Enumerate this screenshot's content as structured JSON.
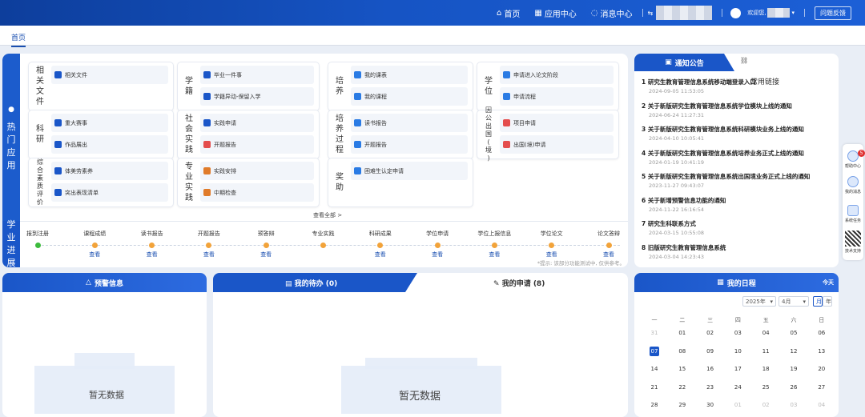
{
  "header": {
    "nav": [
      "首页",
      "应用中心",
      "消息中心"
    ],
    "welcome": "欢迎您,",
    "feedback": "问题反馈"
  },
  "tabs": [
    "首页"
  ],
  "hot_apps": {
    "label": "热门应用",
    "cards": [
      {
        "cat": "相关文件",
        "items": [
          "相关文件"
        ]
      },
      {
        "cat": "学籍",
        "items": [
          "毕业一件事",
          "学籍异动-保留入学"
        ]
      },
      {
        "cat": "培养",
        "items": [
          "我的课表",
          "我的课程"
        ]
      },
      {
        "cat": "学位",
        "items": [
          "申请进入论文阶段",
          "申请流程"
        ]
      },
      {
        "cat": "科研",
        "items": [
          "重大赛事",
          "作品展出"
        ]
      },
      {
        "cat": "社会实践",
        "items": [
          "实践申请",
          "开题报告"
        ]
      },
      {
        "cat": "培养过程",
        "items": [
          "读书报告",
          "开题报告"
        ]
      },
      {
        "cat": "因公出国(境)",
        "items": [
          "项目申请",
          "出国(境)申请"
        ]
      },
      {
        "cat": "综合素质评价",
        "items": [
          "体美劳素养",
          "突出表现清单"
        ]
      },
      {
        "cat": "专业实践",
        "items": [
          "实践安排",
          "中期检查"
        ]
      },
      {
        "cat": "奖助",
        "items": [
          "困难生认定申请"
        ]
      }
    ],
    "see_all": "查看全部 >"
  },
  "progress": {
    "label": "学业进展",
    "steps": [
      {
        "name": "报到注册",
        "status": "done",
        "link": ""
      },
      {
        "name": "课程成绩",
        "status": "pending",
        "link": "查看"
      },
      {
        "name": "读书报告",
        "status": "pending",
        "link": "查看"
      },
      {
        "name": "开题报告",
        "status": "pending",
        "link": "查看"
      },
      {
        "name": "预答辩",
        "status": "pending",
        "link": "查看"
      },
      {
        "name": "专业实践",
        "status": "pending",
        "link": ""
      },
      {
        "name": "科研成果",
        "status": "pending",
        "link": "查看"
      },
      {
        "name": "学位申请",
        "status": "pending",
        "link": "查看"
      },
      {
        "name": "学位上报信息",
        "status": "pending",
        "link": "查看"
      },
      {
        "name": "学位论文",
        "status": "pending",
        "link": "查看"
      },
      {
        "name": "论文答辩",
        "status": "pending",
        "link": "查看"
      }
    ],
    "hint": "*提示: 该部分功能测试中, 仅供参考。",
    "colors": {
      "done": "#3dbb3d",
      "pending": "#f2a33a"
    }
  },
  "notice": {
    "tab": "通知公告",
    "link_tab": "常用链接",
    "items": [
      {
        "n": "1",
        "title": "研究生教育管理信息系统移动端登录入口",
        "date": "2024-09-05 11:53:05"
      },
      {
        "n": "2",
        "title": "关于新版研究生教育管理信息系统学位模块上线的通知",
        "date": "2024-06-24 11:27:31"
      },
      {
        "n": "3",
        "title": "关于新版研究生教育管理信息系统科研模块业务上线的通知",
        "date": "2024-04-10 10:05:41"
      },
      {
        "n": "4",
        "title": "关于新版研究生教育管理信息系统培养业务正式上线的通知",
        "date": "2024-01-19 10:41:19"
      },
      {
        "n": "5",
        "title": "关于新版研究生教育管理信息系统出国境业务正式上线的通知",
        "date": "2023-11-27 09:43:07"
      },
      {
        "n": "6",
        "title": "关于新增预警信息功能的通知",
        "date": "2024-11-22 16:16:54"
      },
      {
        "n": "7",
        "title": "研究生科联系方式",
        "date": "2024-03-15 10:55:08"
      },
      {
        "n": "8",
        "title": "旧版研究生教育管理信息系统",
        "date": "2024-03-04 14:23:43"
      }
    ]
  },
  "warning": {
    "title": "预警信息",
    "empty": "暂无数据"
  },
  "todo": {
    "tab_todo": "我的待办 (0)",
    "tab_apply": "我的申请 (8)",
    "empty": "暂无数据"
  },
  "calendar": {
    "title": "我的日程",
    "today": "今天",
    "year": "2025年",
    "month": "4月",
    "mode_month": "月",
    "mode_year": "年",
    "weekdays": [
      "一",
      "二",
      "三",
      "四",
      "五",
      "六",
      "日"
    ],
    "rows": [
      [
        "31",
        "01",
        "02",
        "03",
        "04",
        "05",
        "06"
      ],
      [
        "07",
        "08",
        "09",
        "10",
        "11",
        "12",
        "13"
      ],
      [
        "14",
        "15",
        "16",
        "17",
        "18",
        "19",
        "20"
      ],
      [
        "21",
        "22",
        "23",
        "24",
        "25",
        "26",
        "27"
      ],
      [
        "28",
        "29",
        "30",
        "01",
        "02",
        "03",
        "04"
      ]
    ]
  },
  "sidebar": {
    "items": [
      "帮助中心",
      "我的消息",
      "系统任务",
      "技术支持"
    ],
    "badge": "5"
  }
}
